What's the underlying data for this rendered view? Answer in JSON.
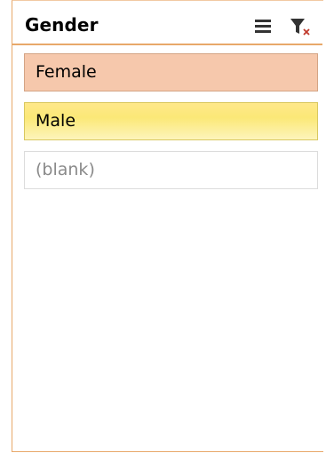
{
  "slicer": {
    "title": "Gender",
    "icons": {
      "multi_select": "multi-select-icon",
      "clear_filter": "clear-filter-icon"
    },
    "items": [
      {
        "label": "Female",
        "state": "selected"
      },
      {
        "label": "Male",
        "state": "hovered"
      },
      {
        "label": "(blank)",
        "state": "no-data"
      }
    ]
  },
  "colors": {
    "accent": "#e8a86a",
    "selected_fill": "#f6c8ac",
    "hover_fill": "#fbe877",
    "no_data_text": "#8a8a8a"
  }
}
